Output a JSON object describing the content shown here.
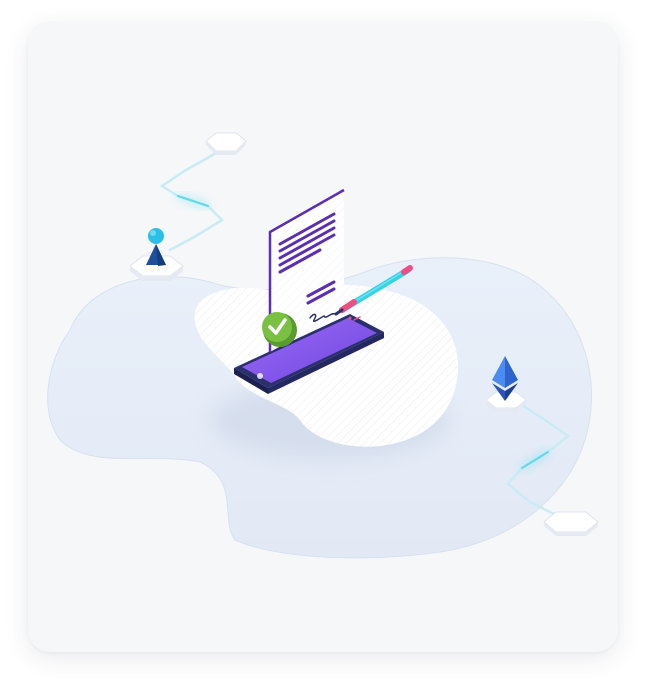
{
  "illustration": {
    "subject": "document-signing-on-phone",
    "colors": {
      "card_background": "#f6f7f9",
      "platform": "#e8eef8",
      "island": "#ffffff",
      "document_line": "#5b2fb0",
      "document_accent": "#6f3fd6",
      "phone_screen": "#8a5cf0",
      "check_badge": "#7ac143",
      "pen_body": "#36d3e6",
      "pen_tip": "#ec4f86",
      "connector_line": "#62d9ea",
      "ethereum_top": "#3d7fe6",
      "ethereum_bottom": "#203f9a",
      "user_head": "#2bc0ea",
      "user_body": "#1d4fa0"
    },
    "icons": [
      "document-icon",
      "checkmark-icon",
      "pen-icon",
      "smartphone-icon",
      "user-icon",
      "ethereum-icon",
      "hexagon-node-icon"
    ]
  }
}
